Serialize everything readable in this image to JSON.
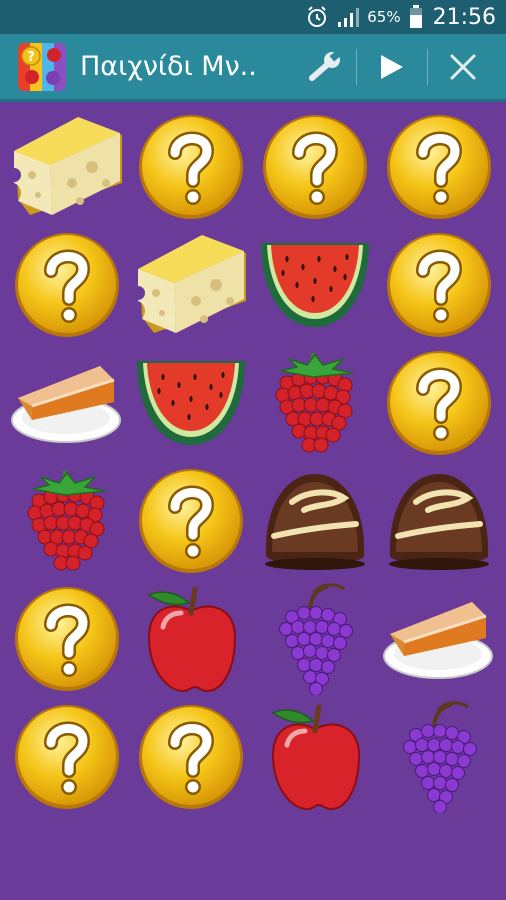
{
  "status_bar": {
    "battery_percent": "65%",
    "time": "21:56",
    "icons": [
      "alarm-icon",
      "signal-icon",
      "battery-icon"
    ]
  },
  "action_bar": {
    "title": "Παιχνίδι Μν..",
    "icons": [
      "app-icon",
      "wrench-icon",
      "play-icon",
      "close-icon"
    ]
  },
  "board": {
    "columns": 4,
    "rows": 6,
    "cards": [
      "cheese",
      "hidden",
      "hidden",
      "hidden",
      "hidden",
      "cheese",
      "watermelon",
      "hidden",
      "pie",
      "watermelon",
      "raspberry",
      "hidden",
      "raspberry",
      "hidden",
      "chocolate",
      "chocolate",
      "hidden",
      "apple",
      "grapes",
      "pie",
      "hidden",
      "hidden",
      "apple",
      "grapes"
    ]
  },
  "colors": {
    "background": "#6a3b98",
    "status_bar": "#1d5e70",
    "action_bar": "#2a8a9c",
    "coin": "#f2c318"
  }
}
